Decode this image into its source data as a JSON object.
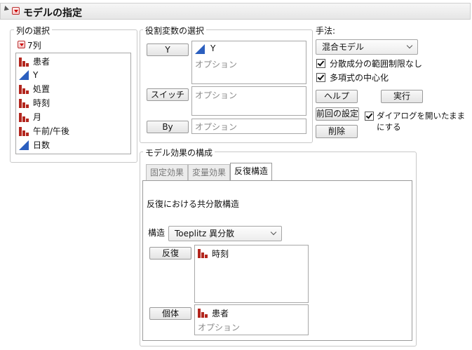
{
  "header": {
    "title": "モデルの指定"
  },
  "columns": {
    "legend": "列の選択",
    "count_label": "7列",
    "items": [
      {
        "label": "患者",
        "type": "nominal"
      },
      {
        "label": "Y",
        "type": "continuous"
      },
      {
        "label": "処置",
        "type": "nominal"
      },
      {
        "label": "時刻",
        "type": "nominal"
      },
      {
        "label": "月",
        "type": "nominal"
      },
      {
        "label": "午前/午後",
        "type": "nominal"
      },
      {
        "label": "日数",
        "type": "continuous"
      }
    ]
  },
  "roles": {
    "legend": "役割変数の選択",
    "y_button": "Y",
    "y_value": "Y",
    "y_option": "オプション",
    "switch_button": "スイッチ",
    "switch_option": "オプション",
    "by_button": "By",
    "by_option": "オプション"
  },
  "method": {
    "label": "手法:",
    "selected": "混合モデル",
    "checkbox_variance_bound": "分散成分の範囲制限なし",
    "checkbox_center_poly": "多項式の中心化",
    "help_button": "ヘルプ",
    "run_button": "実行",
    "recall_button": "前回の設定",
    "remove_button": "削除",
    "keep_dialog_checkbox": "ダイアログを開いたままにする"
  },
  "effects": {
    "legend": "モデル効果の構成",
    "tabs": [
      {
        "label": "固定効果",
        "active": false
      },
      {
        "label": "変量効果",
        "active": false
      },
      {
        "label": "反復構造",
        "active": true
      }
    ],
    "section_title": "反復における共分散構造",
    "structure_label": "構造",
    "structure_selected": "Toeplitz 異分散",
    "repeated_button": "反復",
    "repeated_value": "時刻",
    "subject_button": "個体",
    "subject_value": "患者",
    "subject_option": "オプション"
  },
  "colors": {
    "nominal_icon": "#b3261e",
    "continuous_icon": "#2b5fbf",
    "red_triangle": "#cc0000"
  }
}
